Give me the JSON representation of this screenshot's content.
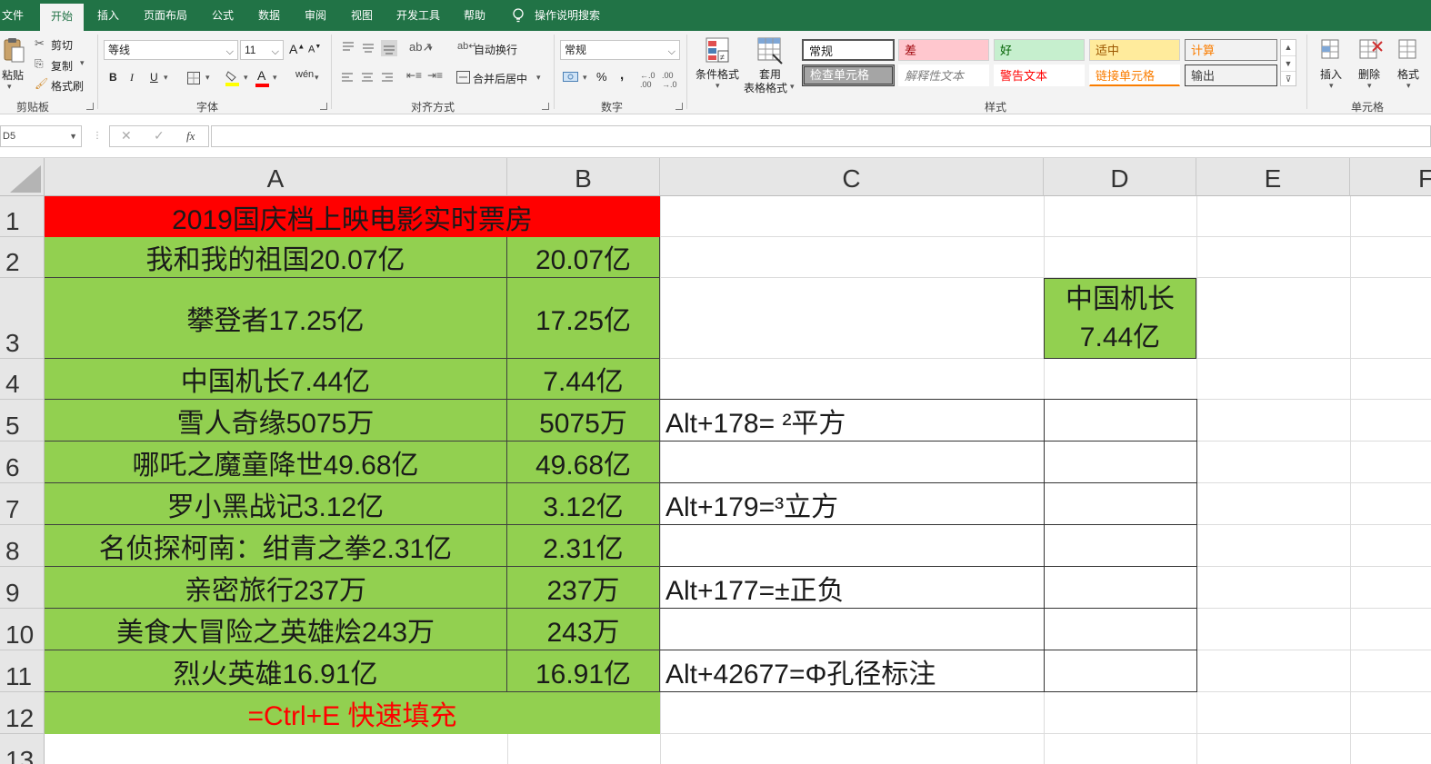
{
  "tabs": [
    {
      "label": "文件",
      "active": false
    },
    {
      "label": "开始",
      "active": true
    },
    {
      "label": "插入",
      "active": false
    },
    {
      "label": "页面布局",
      "active": false
    },
    {
      "label": "公式",
      "active": false
    },
    {
      "label": "数据",
      "active": false
    },
    {
      "label": "审阅",
      "active": false
    },
    {
      "label": "视图",
      "active": false
    },
    {
      "label": "开发工具",
      "active": false
    },
    {
      "label": "帮助",
      "active": false
    }
  ],
  "tell_me": "操作说明搜索",
  "clipboard": {
    "paste": "粘贴",
    "cut": "剪切",
    "copy": "复制",
    "format_painter": "格式刷",
    "group": "剪贴板"
  },
  "font": {
    "name": "等线",
    "size": "11",
    "grow": "A",
    "shrink": "A",
    "bold": "B",
    "italic": "I",
    "underline": "U",
    "group": "字体"
  },
  "alignment": {
    "wrap": "自动换行",
    "merge": "合并后居中",
    "group": "对齐方式"
  },
  "number": {
    "format": "常规",
    "percent": "%",
    "comma": ",",
    "group": "数字"
  },
  "styles": {
    "conditional": "条件格式",
    "table_line1": "套用",
    "table_line2": "表格格式",
    "cells": [
      {
        "label": "常规",
        "bg": "#ffffff",
        "fg": "#222222"
      },
      {
        "label": "差",
        "bg": "#ffc7ce",
        "fg": "#9c0006"
      },
      {
        "label": "好",
        "bg": "#c6efce",
        "fg": "#006100"
      },
      {
        "label": "适中",
        "bg": "#ffeb9c",
        "fg": "#9c5700"
      },
      {
        "label": "计算",
        "bg": "#f2f2f2",
        "fg": "#fa7d00"
      },
      {
        "label": "检查单元格",
        "bg": "#a5a5a5",
        "fg": "#ffffff"
      },
      {
        "label": "解释性文本",
        "bg": "#ffffff",
        "fg": "#7f7f7f"
      },
      {
        "label": "警告文本",
        "bg": "#ffffff",
        "fg": "#ff0000"
      },
      {
        "label": "链接单元格",
        "bg": "#ffffff",
        "fg": "#fa7d00"
      },
      {
        "label": "输出",
        "bg": "#f2f2f2",
        "fg": "#3f3f3f"
      }
    ],
    "group": "样式"
  },
  "cells_group": {
    "insert": "插入",
    "delete": "删除",
    "format": "格式",
    "group": "单元格"
  },
  "formula_bar": {
    "name_box": "D5",
    "cancel": "✕",
    "enter": "✓",
    "fx": "fx",
    "value": ""
  },
  "columns": [
    "A",
    "B",
    "C",
    "D",
    "E",
    "F"
  ],
  "rows": [
    "1",
    "2",
    "3",
    "4",
    "5",
    "6",
    "7",
    "8",
    "9",
    "10",
    "11",
    "12",
    "13"
  ],
  "sheet": {
    "title": "2019国庆档上映电影实时票房",
    "movies": [
      {
        "a": "我和我的祖国20.07亿",
        "b": "20.07亿"
      },
      {
        "a": "攀登者17.25亿",
        "b": "17.25亿"
      },
      {
        "a": "中国机长7.44亿",
        "b": "7.44亿"
      },
      {
        "a": "雪人奇缘5075万",
        "b": "5075万"
      },
      {
        "a": "哪吒之魔童降世49.68亿",
        "b": "49.68亿"
      },
      {
        "a": "罗小黑战记3.12亿",
        "b": "3.12亿"
      },
      {
        "a": "名侦探柯南：绀青之拳2.31亿",
        "b": "2.31亿"
      },
      {
        "a": "亲密旅行237万",
        "b": "237万"
      },
      {
        "a": "美食大冒险之英雄烩243万",
        "b": "243万"
      },
      {
        "a": "烈火英雄16.91亿",
        "b": "16.91亿"
      }
    ],
    "footer": "=Ctrl+E 快速填充",
    "d3_line1": "中国机长",
    "d3_line2": "7.44亿",
    "c5": "Alt+178= ²平方",
    "c7": "Alt+179=³立方",
    "c9": "Alt+177=±正负",
    "c11": "Alt+42677=Φ孔径标注"
  },
  "colors": {
    "excel_green": "#217346",
    "cell_green": "#92d050",
    "title_red": "#ff0000",
    "footer_text_red": "#ff0000"
  }
}
